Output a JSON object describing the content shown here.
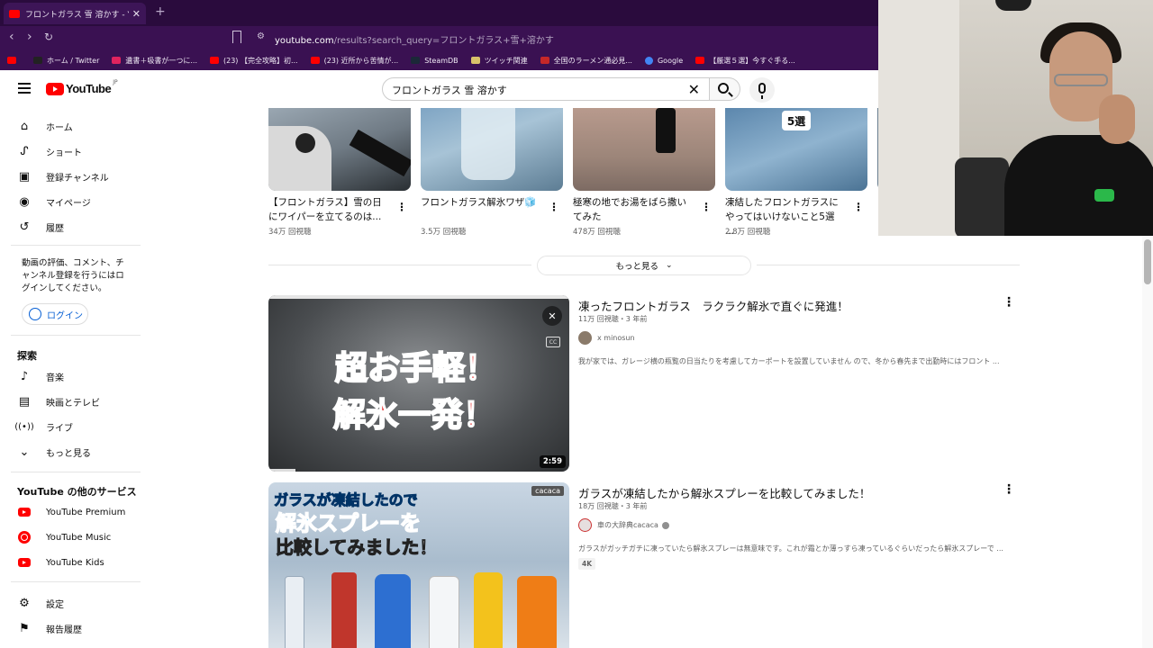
{
  "browser": {
    "tab_title": "フロントガラス 雪 溶かす - YouTube",
    "url_host": "youtube.com",
    "url_path": "/results?search_query=フロントガラス+雪+溶かす",
    "bookmarks": [
      {
        "label": "ホーム / Twitter",
        "color": "#222222"
      },
      {
        "label": "遺書＋吸書が一つに...",
        "color": "#e0245e"
      },
      {
        "label": "(23) 【完全攻略】初...",
        "color": "#ff0000"
      },
      {
        "label": "(23) 近所から苦情が...",
        "color": "#ff0000"
      },
      {
        "label": "SteamDB",
        "color": "#1b2838"
      },
      {
        "label": "ツイッチ関連",
        "color": "#9146ff"
      },
      {
        "label": "全国のラーメン通必見...",
        "color": "#c62828"
      },
      {
        "label": "Google",
        "color": "#4285f4"
      },
      {
        "label": "【厳選５選】今すぐ手る...",
        "color": "#ff0000"
      }
    ]
  },
  "header": {
    "logo_text": "YouTube",
    "logo_region": "JP",
    "search_value": "フロントガラス 雪 溶かす"
  },
  "sidebar": {
    "main_items": [
      {
        "label": "ホーム",
        "icon": "home-icon"
      },
      {
        "label": "ショート",
        "icon": "shorts-icon"
      },
      {
        "label": "登録チャンネル",
        "icon": "subscriptions-icon"
      },
      {
        "label": "マイページ",
        "icon": "account-icon"
      },
      {
        "label": "履歴",
        "icon": "history-icon"
      }
    ],
    "login_note": "動画の評価、コメント、チャンネル登録を行うにはログインしてください。",
    "login_label": "ログイン",
    "explore_heading": "探索",
    "explore_items": [
      {
        "label": "音楽",
        "icon": "music-icon"
      },
      {
        "label": "映画とテレビ",
        "icon": "movies-icon"
      },
      {
        "label": "ライブ",
        "icon": "live-icon"
      },
      {
        "label": "もっと見る",
        "icon": "chevron-down-icon"
      }
    ],
    "services_heading": "YouTube の他のサービス",
    "services": [
      {
        "label": "YouTube Premium"
      },
      {
        "label": "YouTube Music"
      },
      {
        "label": "YouTube Kids"
      }
    ],
    "bottom_items": [
      {
        "label": "設定",
        "icon": "settings-icon"
      },
      {
        "label": "報告履歴",
        "icon": "flag-icon"
      }
    ]
  },
  "shorts": [
    {
      "title": "【フロントガラス】雪の日にワイパーを立てるのは...",
      "views": "34万 回視聴"
    },
    {
      "title": "フロントガラス解氷ワザ🧊",
      "views": "3.5万 回視聴"
    },
    {
      "title": "極寒の地でお湯をばら撒いてみた",
      "views": "478万 回視聴"
    },
    {
      "title": "凍結したフロントガラスにやってはいけないこと5選 ...",
      "views": "2.8万 回視聴",
      "badge": "5選"
    }
  ],
  "more_button": "もっと見る",
  "videos": [
    {
      "title": "凍ったフロントガラス　ラクラク解氷で直ぐに発進！",
      "meta": "11万 回視聴・3 年前",
      "channel": "x minosun",
      "description": "我が家では、ガレージ横の瓶覧の日当たりを考慮してカーポートを設置していません ので、冬から春先まで出勤時にはフロント ...",
      "duration": "2:59",
      "thumb_line1": "超お手軽！",
      "thumb_line2": "解氷一発！"
    },
    {
      "title": "ガラスが凍結したから解氷スプレーを比較してみました！",
      "meta": "18万 回視聴・3 年前",
      "channel": "車の大辞典cacaca",
      "description": "ガラスがガッチガチに凍っていたら解氷スプレーは無意味です。これが霜とか薄っすら凍っているぐらいだったら解氷スプレーで ...",
      "badge": "4K",
      "thumb_line1": "ガラスが凍結したので",
      "thumb_line2": "解氷スプレーを",
      "thumb_line3": "比較してみました！",
      "thumb_brand": "cacaca"
    }
  ]
}
